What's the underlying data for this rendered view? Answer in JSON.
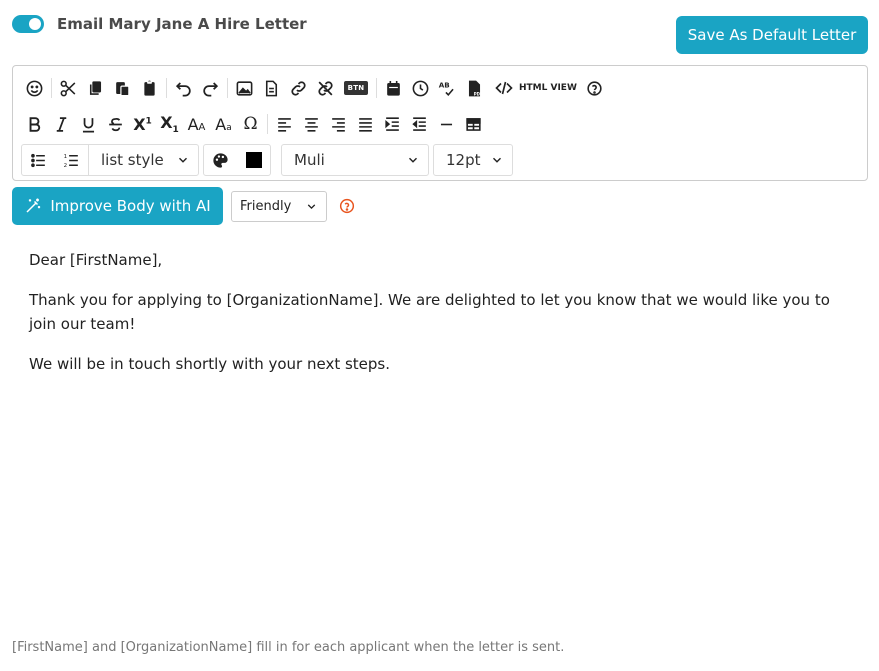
{
  "colors": {
    "accent": "#1aa4c4",
    "help_icon": "#e8541e"
  },
  "header": {
    "toggle_on": true,
    "title": "Email Mary Jane A Hire Letter",
    "save_default_label": "Save As Default Letter"
  },
  "toolbar": {
    "row1_icons": [
      "emoji-icon",
      "cut-icon",
      "copy-icon",
      "paste-icon",
      "paste-text-icon",
      "undo-icon",
      "redo-icon",
      "image-icon",
      "document-icon",
      "link-icon",
      "unlink-icon",
      "button-icon",
      "calendar-icon",
      "clock-icon",
      "spellcheck-icon",
      "pdf-icon",
      "code-icon",
      "help-icon"
    ],
    "btn_chip": "BTN",
    "html_view_label": "HTML VIEW",
    "row2_icons": [
      "bold-icon",
      "italic-icon",
      "underline-icon",
      "strikethrough-icon",
      "superscript-icon",
      "subscript-icon",
      "font-size-up-icon",
      "font-size-down-icon",
      "omega-icon",
      "align-left-icon",
      "align-center-icon",
      "align-right-icon",
      "justify-icon",
      "indent-icon",
      "outdent-icon",
      "horizontal-rule-icon",
      "table-icon"
    ],
    "list_style_label": "list style",
    "font_family": "Muli",
    "font_size": "12pt",
    "text_color": "#000000"
  },
  "ai": {
    "improve_label": "Improve Body with AI",
    "tone": "Friendly"
  },
  "body": {
    "paragraphs": [
      "Dear [FirstName],",
      "Thank you for applying to [OrganizationName]. We are delighted to let you know that we would like you to join our team!",
      "We will be in touch shortly with your next steps."
    ]
  },
  "footnote": "[FirstName] and [OrganizationName] fill in for each applicant when the letter is sent."
}
